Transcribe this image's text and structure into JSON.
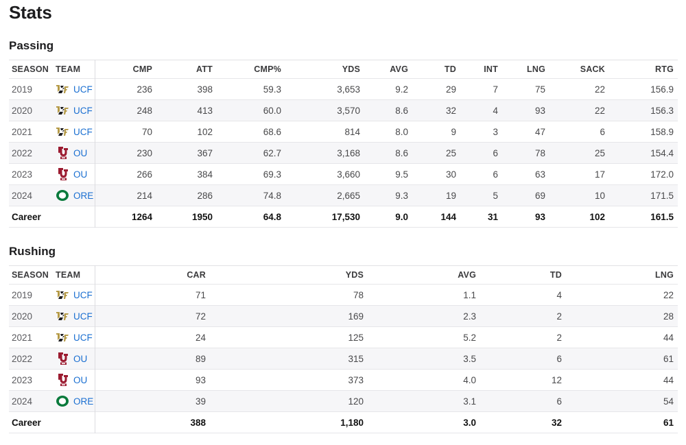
{
  "page": {
    "title": "Stats"
  },
  "passing": {
    "title": "Passing",
    "headers": [
      "SEASON",
      "TEAM",
      "CMP",
      "ATT",
      "CMP%",
      "YDS",
      "AVG",
      "TD",
      "INT",
      "LNG",
      "SACK",
      "RTG"
    ],
    "rows": [
      {
        "season": "2019",
        "team": "UCF",
        "logo": "ucf-logo-icon",
        "stats": [
          "236",
          "398",
          "59.3",
          "3,653",
          "9.2",
          "29",
          "7",
          "75",
          "22",
          "156.9"
        ]
      },
      {
        "season": "2020",
        "team": "UCF",
        "logo": "ucf-logo-icon",
        "stats": [
          "248",
          "413",
          "60.0",
          "3,570",
          "8.6",
          "32",
          "4",
          "93",
          "22",
          "156.3"
        ]
      },
      {
        "season": "2021",
        "team": "UCF",
        "logo": "ucf-logo-icon",
        "stats": [
          "70",
          "102",
          "68.6",
          "814",
          "8.0",
          "9",
          "3",
          "47",
          "6",
          "158.9"
        ]
      },
      {
        "season": "2022",
        "team": "OU",
        "logo": "ou-logo-icon",
        "stats": [
          "230",
          "367",
          "62.7",
          "3,168",
          "8.6",
          "25",
          "6",
          "78",
          "25",
          "154.4"
        ]
      },
      {
        "season": "2023",
        "team": "OU",
        "logo": "ou-logo-icon",
        "stats": [
          "266",
          "384",
          "69.3",
          "3,660",
          "9.5",
          "30",
          "6",
          "63",
          "17",
          "172.0"
        ]
      },
      {
        "season": "2024",
        "team": "ORE",
        "logo": "oregon-logo-icon",
        "stats": [
          "214",
          "286",
          "74.8",
          "2,665",
          "9.3",
          "19",
          "5",
          "69",
          "10",
          "171.5"
        ]
      }
    ],
    "career": {
      "label": "Career",
      "stats": [
        "1264",
        "1950",
        "64.8",
        "17,530",
        "9.0",
        "144",
        "31",
        "93",
        "102",
        "161.5"
      ]
    }
  },
  "rushing": {
    "title": "Rushing",
    "headers": [
      "SEASON",
      "TEAM",
      "CAR",
      "YDS",
      "AVG",
      "TD",
      "LNG"
    ],
    "rows": [
      {
        "season": "2019",
        "team": "UCF",
        "logo": "ucf-logo-icon",
        "stats": [
          "71",
          "78",
          "1.1",
          "4",
          "22"
        ]
      },
      {
        "season": "2020",
        "team": "UCF",
        "logo": "ucf-logo-icon",
        "stats": [
          "72",
          "169",
          "2.3",
          "2",
          "28"
        ]
      },
      {
        "season": "2021",
        "team": "UCF",
        "logo": "ucf-logo-icon",
        "stats": [
          "24",
          "125",
          "5.2",
          "2",
          "44"
        ]
      },
      {
        "season": "2022",
        "team": "OU",
        "logo": "ou-logo-icon",
        "stats": [
          "89",
          "315",
          "3.5",
          "6",
          "61"
        ]
      },
      {
        "season": "2023",
        "team": "OU",
        "logo": "ou-logo-icon",
        "stats": [
          "93",
          "373",
          "4.0",
          "12",
          "44"
        ]
      },
      {
        "season": "2024",
        "team": "ORE",
        "logo": "oregon-logo-icon",
        "stats": [
          "39",
          "120",
          "3.1",
          "6",
          "54"
        ]
      }
    ],
    "career": {
      "label": "Career",
      "stats": [
        "388",
        "1,180",
        "3.0",
        "32",
        "61"
      ]
    }
  },
  "colors": {
    "link": "#1a6fd1",
    "ucf_gold": "#b59a47",
    "ou_crimson": "#9b1b30",
    "oregon_green": "#0a7a3c",
    "alt_row": "#f6f6f8"
  }
}
